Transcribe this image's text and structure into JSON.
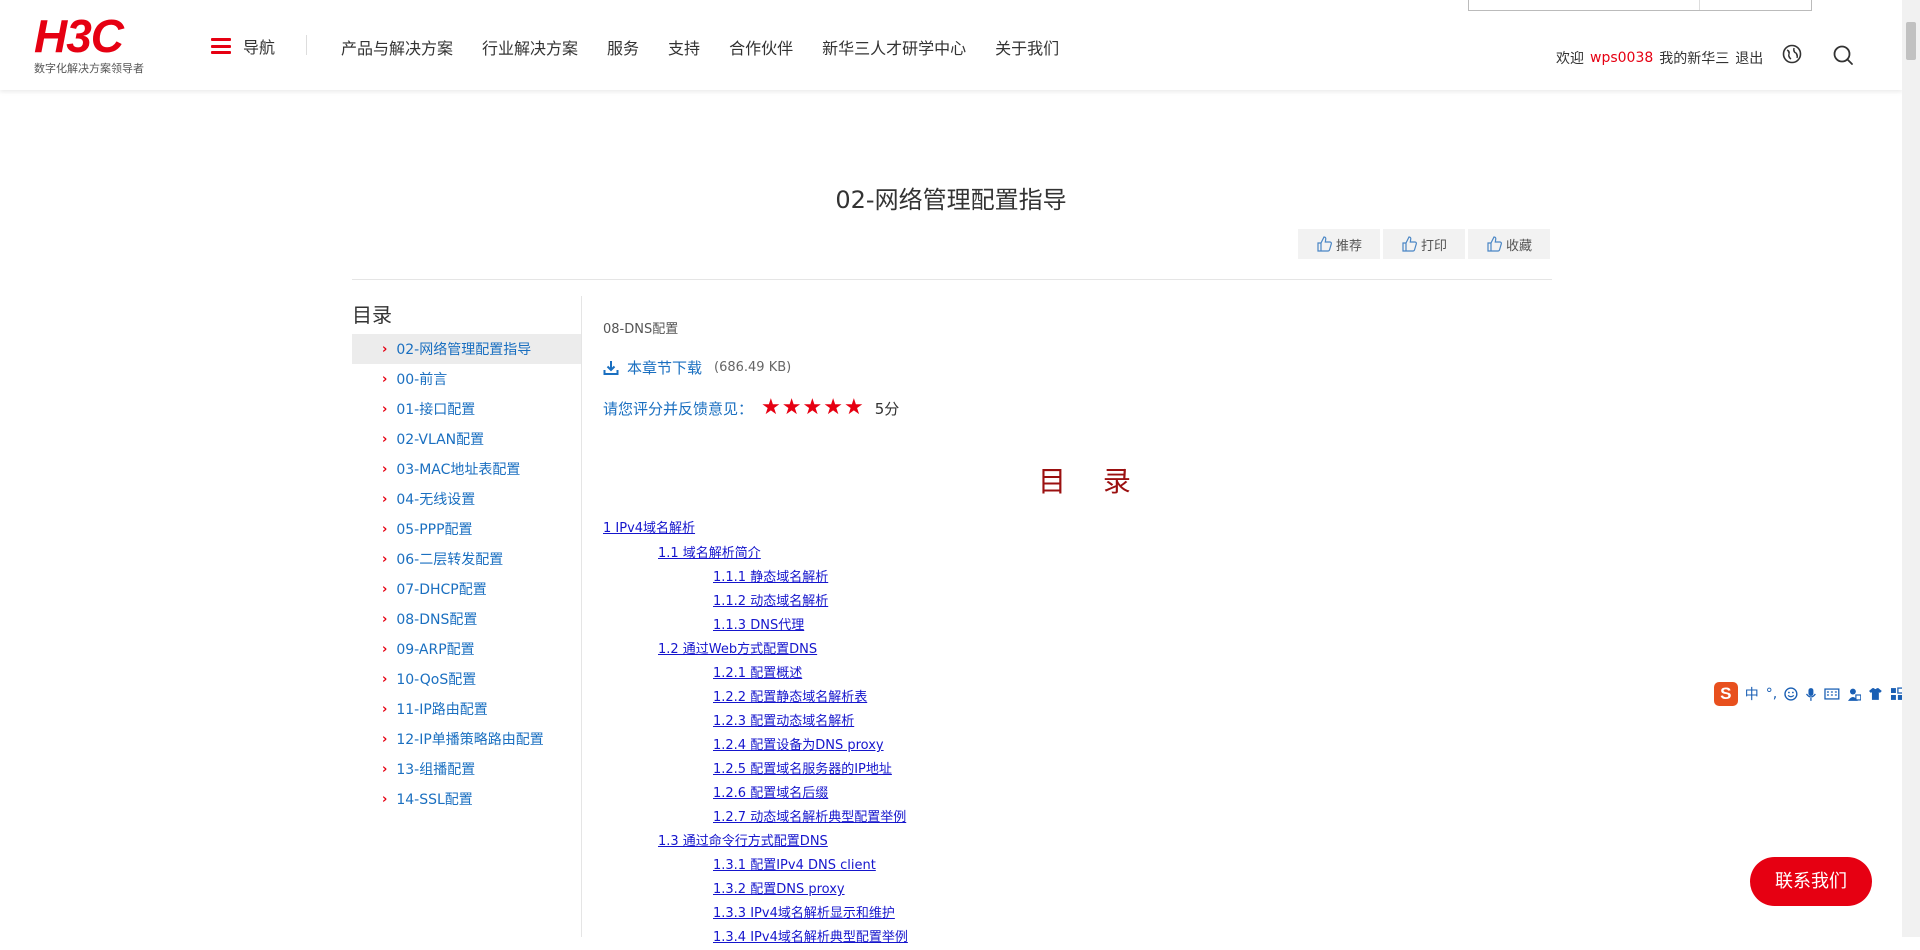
{
  "header": {
    "logo_text": "H3C",
    "logo_sub": "数字化解决方案领导者",
    "nav_label": "导航",
    "links": [
      "产品与解决方案",
      "行业解决方案",
      "服务",
      "支持",
      "合作伙伴",
      "新华三人才研学中心",
      "关于我们"
    ],
    "welcome": "欢迎",
    "username": "wps0038",
    "my_account": "我的新华三",
    "logout": "退出"
  },
  "page": {
    "title": "02-网络管理配置指导",
    "actions": {
      "recommend": "推荐",
      "print": "打印",
      "favorite": "收藏"
    }
  },
  "sidebar": {
    "heading": "目录",
    "items": [
      "02-网络管理配置指导",
      "00-前言",
      "01-接口配置",
      "02-VLAN配置",
      "03-MAC地址表配置",
      "04-无线设置",
      "05-PPP配置",
      "06-二层转发配置",
      "07-DHCP配置",
      "08-DNS配置",
      "09-ARP配置",
      "10-QoS配置",
      "11-IP路由配置",
      "12-IP单播策略路由配置",
      "13-组播配置",
      "14-SSL配置"
    ],
    "active_index": 0
  },
  "content": {
    "section_name": "08-DNS配置",
    "download_label": "本章节下载",
    "download_size": "(686.49 KB)",
    "rating_label": "请您评分并反馈意见：",
    "stars": 5,
    "score": "5分",
    "toc_heading": "目 录",
    "toc": [
      {
        "level": 1,
        "text": "1 IPv4域名解析"
      },
      {
        "level": 2,
        "text": "1.1 域名解析简介"
      },
      {
        "level": 3,
        "text": "1.1.1 静态域名解析"
      },
      {
        "level": 3,
        "text": "1.1.2 动态域名解析"
      },
      {
        "level": 3,
        "text": "1.1.3 DNS代理"
      },
      {
        "level": 2,
        "text": "1.2 通过Web方式配置DNS"
      },
      {
        "level": 3,
        "text": "1.2.1 配置概述"
      },
      {
        "level": 3,
        "text": "1.2.2 配置静态域名解析表"
      },
      {
        "level": 3,
        "text": "1.2.3 配置动态域名解析"
      },
      {
        "level": 3,
        "text": "1.2.4 配置设备为DNS proxy"
      },
      {
        "level": 3,
        "text": "1.2.5 配置域名服务器的IP地址"
      },
      {
        "level": 3,
        "text": "1.2.6 配置域名后缀"
      },
      {
        "level": 3,
        "text": "1.2.7 动态域名解析典型配置举例"
      },
      {
        "level": 2,
        "text": "1.3 通过命令行方式配置DNS"
      },
      {
        "level": 3,
        "text": "1.3.1 配置IPv4 DNS client"
      },
      {
        "level": 3,
        "text": "1.3.2 配置DNS proxy"
      },
      {
        "level": 3,
        "text": "1.3.3 IPv4域名解析显示和维护"
      },
      {
        "level": 3,
        "text": "1.3.4 IPv4域名解析典型配置举例"
      }
    ]
  },
  "ime": {
    "logo": "S",
    "mode": "中",
    "punct": "°,"
  },
  "contact_label": "联系我们",
  "colors": {
    "brand": "#e60012",
    "link": "#1a6fc0",
    "toc_link": "#1515cc",
    "toc_heading": "#9b1010"
  }
}
